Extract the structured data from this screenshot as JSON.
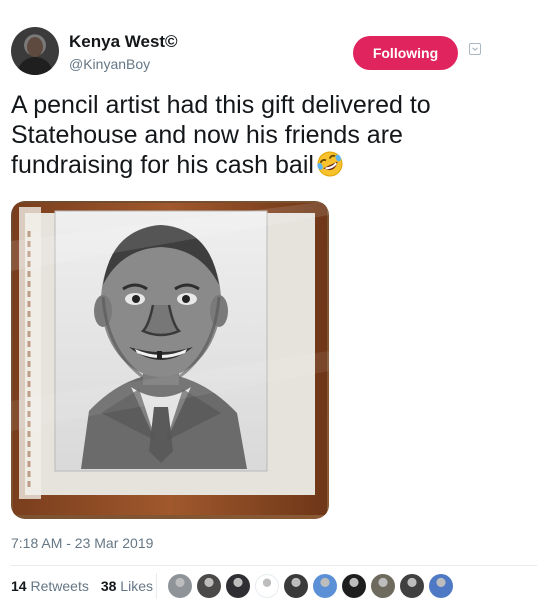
{
  "author": {
    "display_name": "Kenya West©",
    "handle": "@KinyanBoy",
    "avatar_icon": "profile-photo"
  },
  "follow_button": {
    "label": "Following",
    "color": "#e0245e"
  },
  "menu_icon": "chevron-down-icon",
  "tweet": {
    "text": "A pencil artist had this gift delivered to Statehouse and now his friends are fundraising for his cash bail",
    "emoji": "rolling-on-the-floor-laughing"
  },
  "media": {
    "description_icon": "framed-pencil-portrait"
  },
  "timestamp": "7:18 AM - 23 Mar 2019",
  "stats": {
    "retweets_count": "14",
    "retweets_label": "Retweets",
    "likes_count": "38",
    "likes_label": "Likes"
  },
  "likers": [
    {
      "color": "#8f9499"
    },
    {
      "color": "#4c4a48"
    },
    {
      "color": "#2f2f33"
    },
    {
      "color": "#ffffff"
    },
    {
      "color": "#3a3a3a"
    },
    {
      "color": "#5b8fd6"
    },
    {
      "color": "#1e1e1e"
    },
    {
      "color": "#6f6a5e"
    },
    {
      "color": "#404040"
    },
    {
      "color": "#4f79c4"
    }
  ]
}
